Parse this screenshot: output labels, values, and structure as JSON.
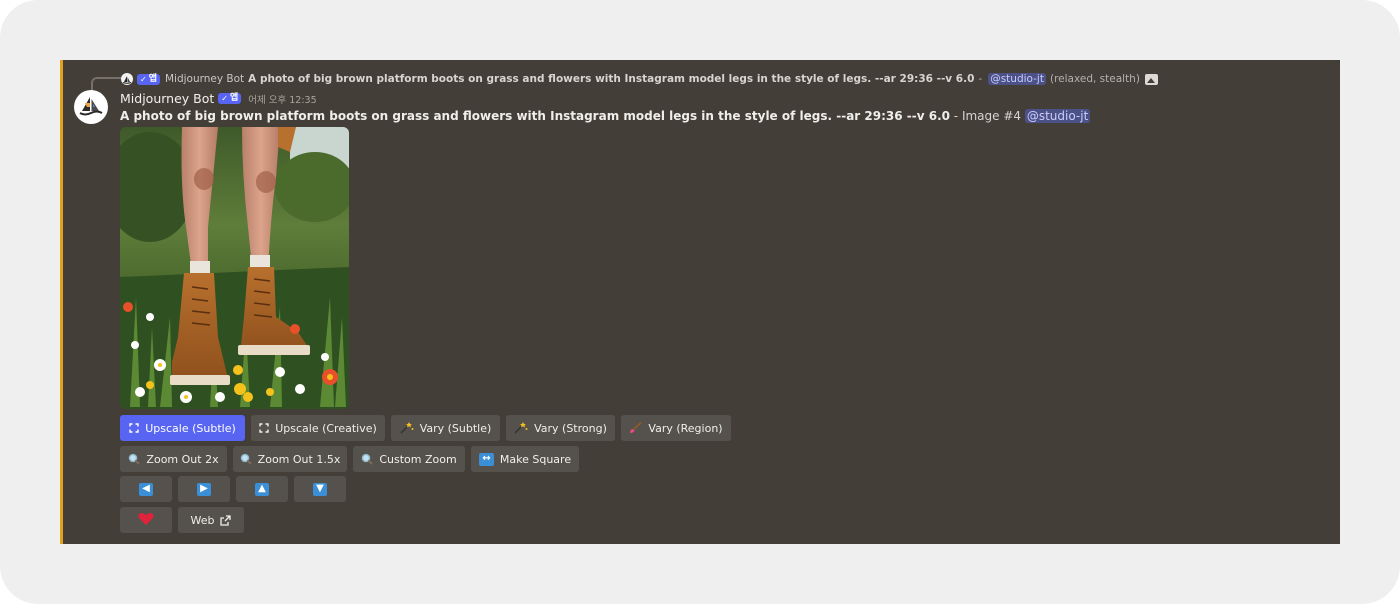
{
  "colors": {
    "panel_bg": "#433e38",
    "accent_bar": "#e2a01f",
    "primary_button": "#5865f2",
    "button": "#55514c",
    "mention_bg": "#4c5288"
  },
  "reply": {
    "author": "Midjourney Bot",
    "app_tag": "앱",
    "prompt": "A photo of big brown platform boots on grass and flowers with Instagram model legs in the style of legs. --ar 29:36 --v 6.0",
    "separator": "-",
    "mention": "@studio-jt",
    "suffix": "(relaxed, stealth)",
    "image_icon": "image-icon"
  },
  "message": {
    "author": "Midjourney Bot",
    "app_tag": "앱",
    "timestamp": "어제 오후 12:35",
    "prompt": "A photo of big brown platform boots on grass and flowers with Instagram model legs in the style of legs. --ar 29:36 --v 6.0",
    "image_label": " - Image #4 ",
    "mention": "@studio-jt",
    "attachment_icon": "generated-image"
  },
  "buttons": {
    "row1": [
      {
        "label": "Upscale (Subtle)",
        "icon": "upscale-icon"
      },
      {
        "label": "Upscale (Creative)",
        "icon": "upscale-icon"
      },
      {
        "label": "Vary (Subtle)",
        "icon": "magic-wand-icon"
      },
      {
        "label": "Vary (Strong)",
        "icon": "magic-wand-icon"
      },
      {
        "label": "Vary (Region)",
        "icon": "paintbrush-icon"
      }
    ],
    "row2": [
      {
        "label": "Zoom Out 2x",
        "icon": "magnifier-icon"
      },
      {
        "label": "Zoom Out 1.5x",
        "icon": "magnifier-icon"
      },
      {
        "label": "Custom Zoom",
        "icon": "magnifier-icon"
      },
      {
        "label": "Make Square",
        "icon": "left-right-arrow-icon"
      }
    ],
    "row3": [
      {
        "label": "◀",
        "icon": "arrow-left-icon"
      },
      {
        "label": "▶",
        "icon": "arrow-right-icon"
      },
      {
        "label": "▲",
        "icon": "arrow-up-icon"
      },
      {
        "label": "▼",
        "icon": "arrow-down-icon"
      }
    ],
    "row4": [
      {
        "label": "",
        "icon": "heart-icon"
      },
      {
        "label": "Web",
        "icon": "external-link-icon"
      }
    ]
  }
}
